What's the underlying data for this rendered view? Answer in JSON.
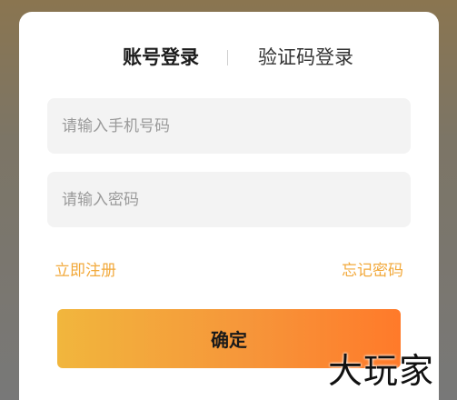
{
  "tabs": {
    "account_login": "账号登录",
    "code_login": "验证码登录"
  },
  "form": {
    "phone_placeholder": "请输入手机号码",
    "password_placeholder": "请输入密码",
    "register_label": "立即注册",
    "forgot_label": "忘记密码",
    "confirm_label": "确定"
  },
  "watermark": "大玩家",
  "colors": {
    "accent": "#f2a93b",
    "button_gradient_start": "#f1b63d",
    "button_gradient_end": "#ff7a2a",
    "field_background": "#f3f3f3"
  }
}
